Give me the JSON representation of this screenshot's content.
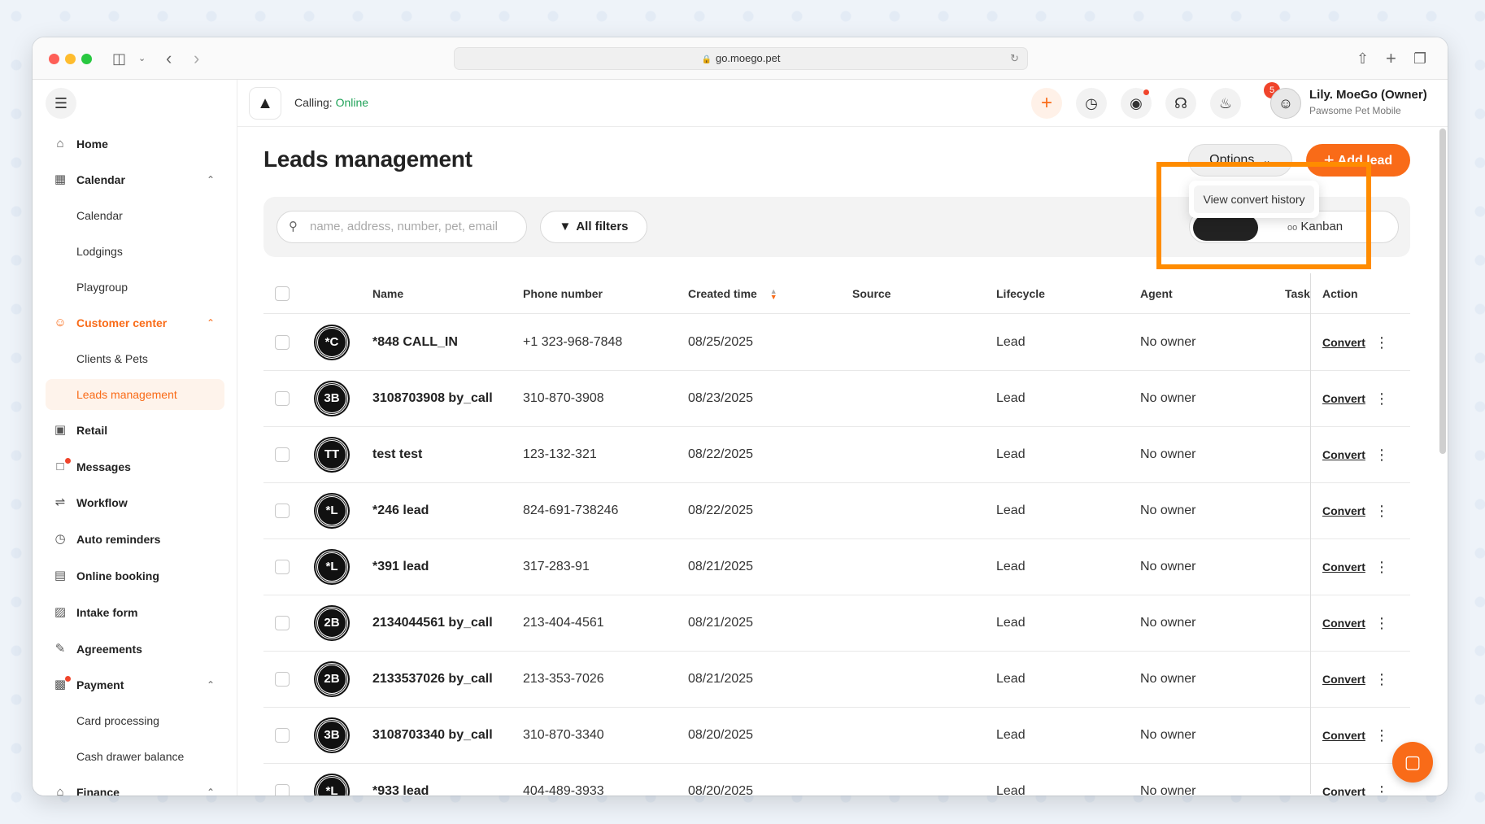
{
  "browser": {
    "url": "go.moego.pet"
  },
  "sidebar": {
    "home": "Home",
    "calendar": "Calendar",
    "calendar_sub": [
      "Calendar",
      "Lodgings",
      "Playgroup"
    ],
    "customer_center": "Customer center",
    "customer_sub": [
      "Clients & Pets",
      "Leads management"
    ],
    "retail": "Retail",
    "messages": "Messages",
    "workflow": "Workflow",
    "auto_reminders": "Auto reminders",
    "online_booking": "Online booking",
    "intake_form": "Intake form",
    "agreements": "Agreements",
    "payment": "Payment",
    "payment_sub": [
      "Card processing",
      "Cash drawer balance"
    ],
    "finance": "Finance"
  },
  "topbar": {
    "calling_label": "Calling:",
    "calling_status": "Online",
    "notification_count": "5",
    "user_name": "Lily. MoeGo (Owner)",
    "user_business": "Pawsome Pet Mobile"
  },
  "page": {
    "title": "Leads management",
    "options_label": "Options",
    "add_lead_label": "Add lead",
    "dropdown_item": "View convert history",
    "search_placeholder": "name, address, number, pet, email",
    "all_filters": "All filters",
    "kanban_label": "Kanban"
  },
  "table": {
    "columns": [
      "Name",
      "Phone number",
      "Created time",
      "Source",
      "Lifecycle",
      "Agent",
      "Task",
      "Action"
    ],
    "action_label": "Convert",
    "rows": [
      {
        "initials": "*C",
        "name": "*848 CALL_IN",
        "phone": "+1 323-968-7848",
        "created": "08/25/2025",
        "source": "",
        "lifecycle": "Lead",
        "agent": "No owner"
      },
      {
        "initials": "3B",
        "name": "3108703908 by_call",
        "phone": "310-870-3908",
        "created": "08/23/2025",
        "source": "",
        "lifecycle": "Lead",
        "agent": "No owner"
      },
      {
        "initials": "TT",
        "name": "test test",
        "phone": "123-132-321",
        "created": "08/22/2025",
        "source": "",
        "lifecycle": "Lead",
        "agent": "No owner"
      },
      {
        "initials": "*L",
        "name": "*246 lead",
        "phone": "824-691-738246",
        "created": "08/22/2025",
        "source": "",
        "lifecycle": "Lead",
        "agent": "No owner"
      },
      {
        "initials": "*L",
        "name": "*391 lead",
        "phone": "317-283-91",
        "created": "08/21/2025",
        "source": "",
        "lifecycle": "Lead",
        "agent": "No owner"
      },
      {
        "initials": "2B",
        "name": "2134044561 by_call",
        "phone": "213-404-4561",
        "created": "08/21/2025",
        "source": "",
        "lifecycle": "Lead",
        "agent": "No owner"
      },
      {
        "initials": "2B",
        "name": "2133537026 by_call",
        "phone": "213-353-7026",
        "created": "08/21/2025",
        "source": "",
        "lifecycle": "Lead",
        "agent": "No owner"
      },
      {
        "initials": "3B",
        "name": "3108703340 by_call",
        "phone": "310-870-3340",
        "created": "08/20/2025",
        "source": "",
        "lifecycle": "Lead",
        "agent": "No owner"
      },
      {
        "initials": "*L",
        "name": "*933 lead",
        "phone": "404-489-3933",
        "created": "08/20/2025",
        "source": "",
        "lifecycle": "Lead",
        "agent": "No owner"
      }
    ]
  }
}
